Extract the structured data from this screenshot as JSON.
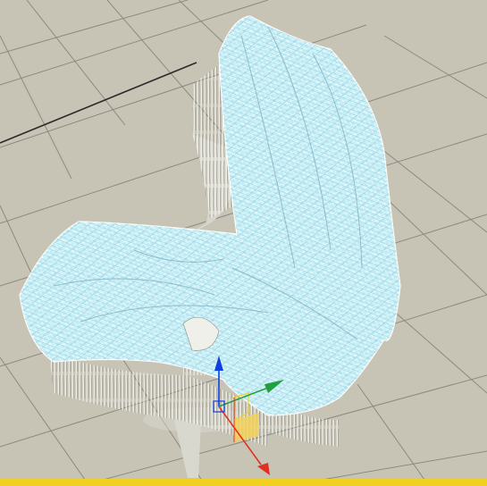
{
  "viewport": {
    "name": "Perspective",
    "frame_color": "#f0d020",
    "floor_color": "#c7c4b6",
    "grid_color": "#8c8a80",
    "grid_major_color": "#2a2a2a"
  },
  "scene": {
    "object": "cloth-draped-chair",
    "mesh_color": "#bfeef7",
    "wire_color": "#ffffff",
    "chair_color": "#d9d8cf"
  },
  "gizmo": {
    "icon": "move-transform-gizmo",
    "x_color": "#e03020",
    "y_color": "#20a040",
    "z_color": "#1040e0",
    "plane_color": "#f2d15a"
  }
}
